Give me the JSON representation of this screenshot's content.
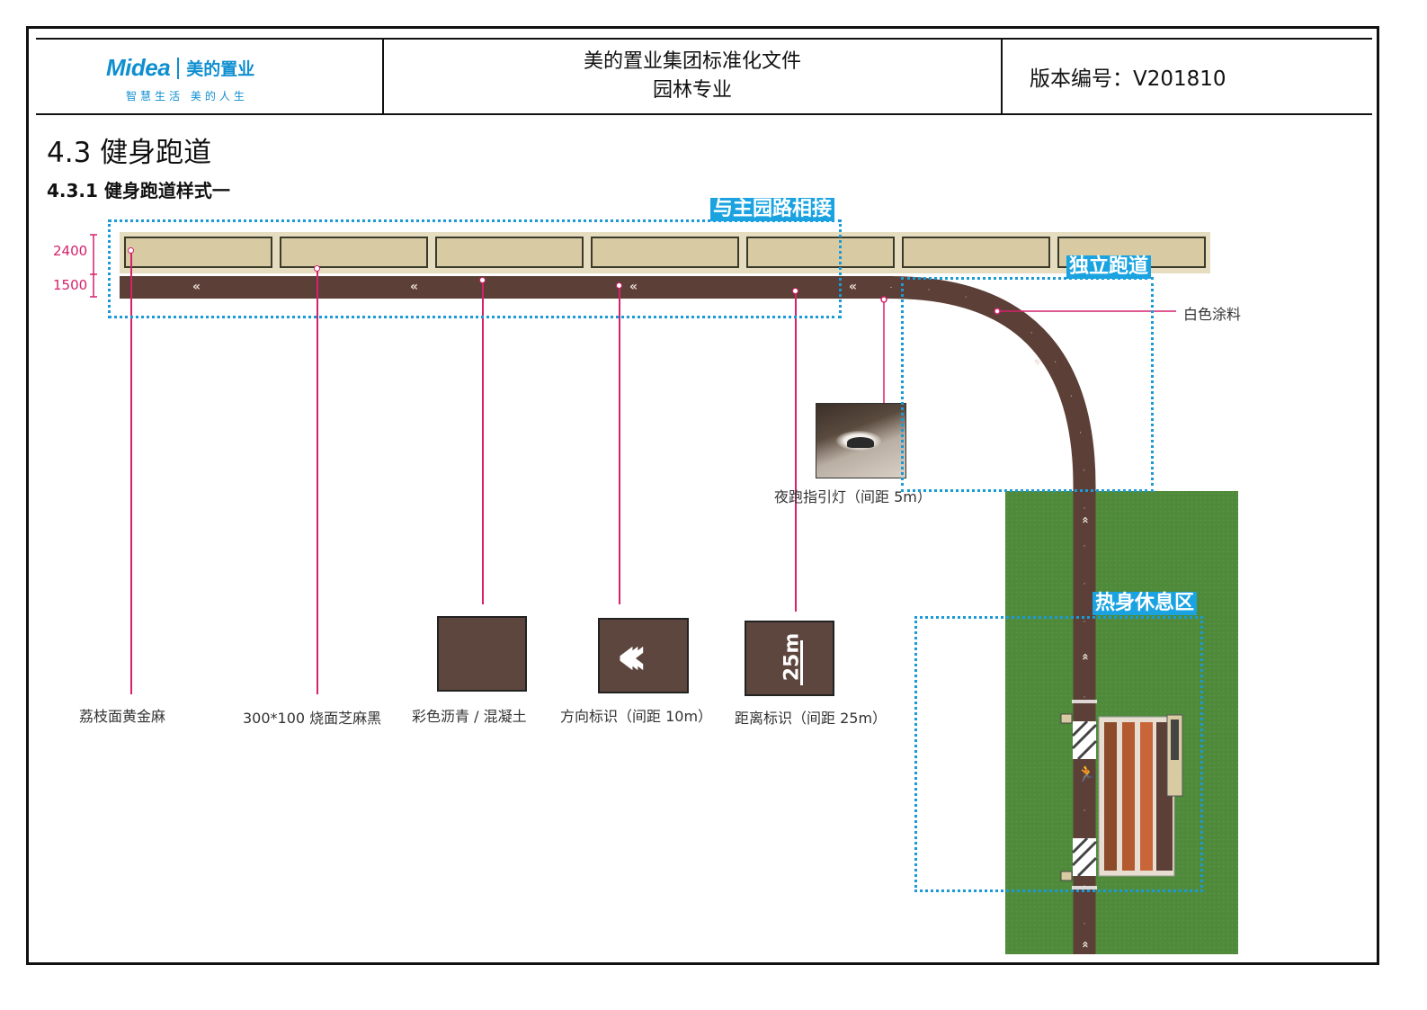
{
  "header": {
    "logo_word": "Midea",
    "logo_cn": "美的置业",
    "logo_slogan": "智慧生活 美的人生",
    "doc_title_line1": "美的置业集团标准化文件",
    "doc_title_line2": "园林专业",
    "version": "版本编号：V201810"
  },
  "section": {
    "title": "4.3 健身跑道",
    "subtitle": "4.3.1 健身跑道样式一"
  },
  "zones": {
    "main_road": "与主园路相接",
    "independent": "独立跑道",
    "warmup": "热身休息区"
  },
  "dimensions": {
    "d1": "2400",
    "d2": "1500"
  },
  "callouts": {
    "white_paint": "白色涂料",
    "night_lamp": "夜跑指引灯（间距 5m）",
    "granite_yellow": "荔枝面黄金麻",
    "granite_black": "300*100 烧面芝麻黑",
    "asphalt": "彩色沥青 / 混凝土",
    "direction": "方向标识（间距 10m）",
    "distance": "距离标识（间距 25m）"
  },
  "swatch_text": {
    "distance_mark": "25m"
  },
  "colors": {
    "track": "#5c3f36",
    "leader": "#d6216c",
    "zone_outline": "#1a9ad6",
    "grass": "#4f8a3a",
    "paving": "#d8cba4"
  },
  "icons": {
    "direction": "chevron-left-icon",
    "runner": "runner-icon"
  }
}
